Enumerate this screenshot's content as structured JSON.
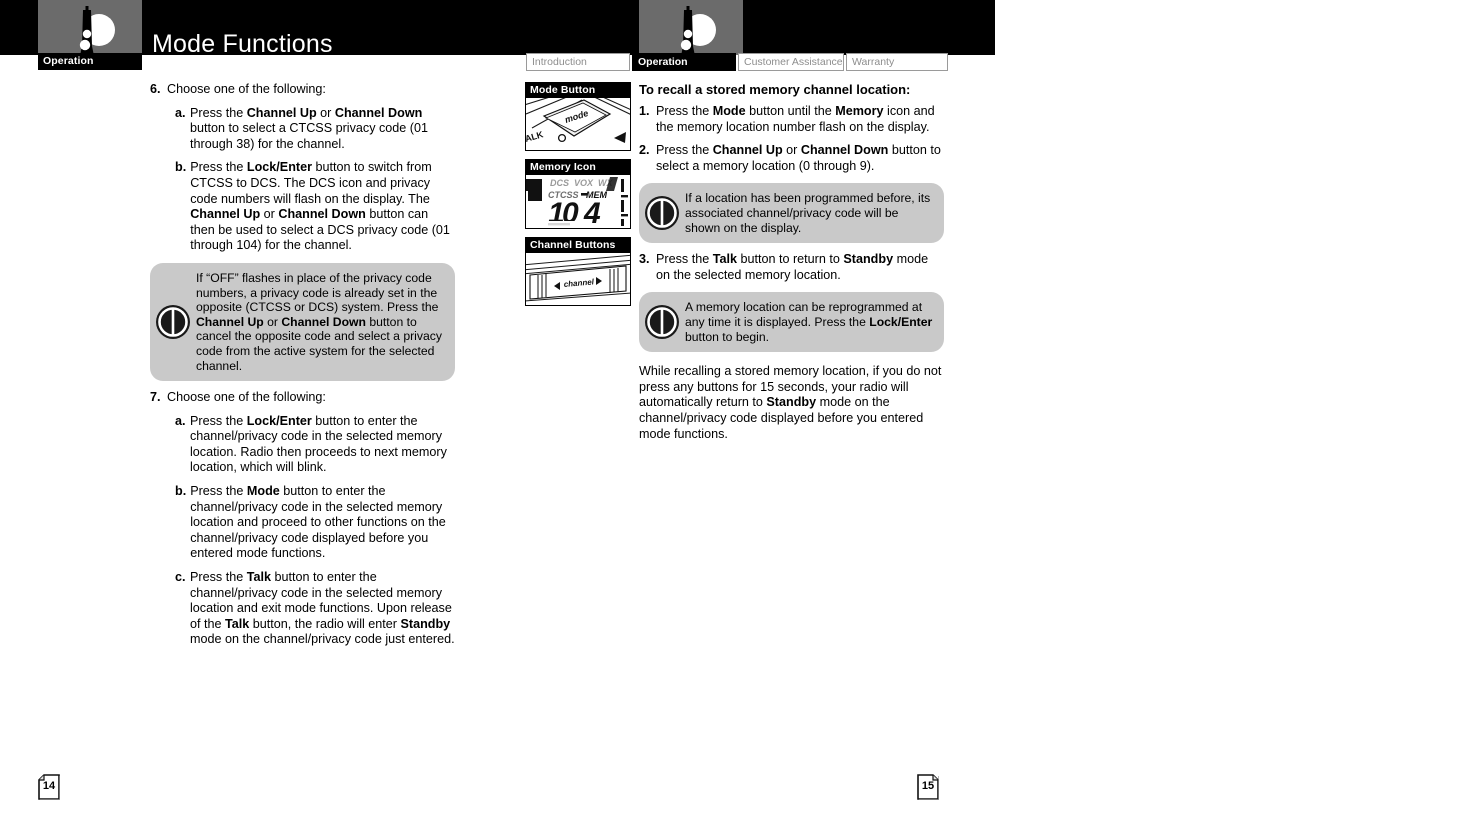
{
  "header": {
    "title": "Mode Functions",
    "logo_tab_label": "Operation",
    "logo_icon": "walkie-talkie-logo-icon"
  },
  "tabs": [
    {
      "label": "Introduction",
      "active": false
    },
    {
      "label": "Operation",
      "active": true
    },
    {
      "label": "Customer Assistance",
      "active": false
    },
    {
      "label": "Warranty",
      "active": false
    }
  ],
  "left_page": {
    "page_number": "14",
    "steps": [
      {
        "marker": "6.",
        "text": "Choose one of the following:",
        "substeps": [
          {
            "marker": "a.",
            "html": "Press the <b>Channel Up</b> or <b>Channel Down</b> button to select a CTCSS privacy code (01 through 38) for the channel."
          },
          {
            "marker": "b.",
            "html": "Press the <b>Lock/Enter</b> button to switch from CTCSS to DCS. The DCS icon and privacy code numbers will flash on the display. The <b>Channel Up</b> or <b>Channel Down</b> button can then be used to select a DCS privacy code (01 through 104) for the channel."
          }
        ]
      }
    ],
    "note": {
      "icon": "note-info-icon",
      "html": "If “OFF” flashes in place of the privacy code numbers, a privacy code is already set in the opposite (CTCSS or DCS) system. Press the <b>Channel Up</b> or <b>Channel Down</b> button to cancel the opposite code and select a privacy code from the active system for the selected channel."
    },
    "steps2": [
      {
        "marker": "7.",
        "text": "Choose one of the following:",
        "substeps": [
          {
            "marker": "a.",
            "html": "Press the <b>Lock/Enter</b> button to enter the channel/privacy code in the selected memory location. Radio then proceeds to next memory location, which will blink."
          },
          {
            "marker": "b.",
            "html": "Press the <b>Mode</b> button to enter the channel/privacy code in the selected memory location and proceed to other functions on the channel/privacy code displayed before you entered mode functions."
          },
          {
            "marker": "c.",
            "html": "Press the <b>Talk</b> button to enter the channel/privacy code in the selected memory location and exit mode functions. Upon release of the <b>Talk</b> button, the radio will enter <b>Standby</b> mode on the channel/privacy code just entered."
          }
        ]
      }
    ]
  },
  "figures": [
    {
      "caption": "Mode Button",
      "art": "mode-button-photo"
    },
    {
      "caption": "Memory Icon",
      "art": "memory-icon-lcd"
    },
    {
      "caption": "Channel Buttons",
      "art": "channel-buttons-photo"
    }
  ],
  "lcd": {
    "labels_top": [
      "DCS",
      "VOX",
      "WX"
    ],
    "labels_second": [
      "CTCSS",
      "MEM"
    ],
    "digits": "104"
  },
  "right_page": {
    "page_number": "15",
    "heading": "To recall a stored memory channel location:",
    "steps": [
      {
        "marker": "1.",
        "html": "Press the <b>Mode</b> button until the <b>Memory</b> icon and the memory location number flash on the display."
      },
      {
        "marker": "2.",
        "html": "Press the <b>Channel Up</b> or <b>Channel Down</b> button to select a memory location (0 through 9)."
      }
    ],
    "note1": {
      "icon": "note-info-icon",
      "html": "If a location has been programmed before, its associated channel/privacy code will be shown on the display."
    },
    "step3": {
      "marker": "3.",
      "html": "Press the <b>Talk</b> button to return to <b>Standby</b> mode on the selected memory location."
    },
    "note2": {
      "icon": "note-info-icon",
      "html": "A memory location can be reprogrammed at any time it is displayed. Press the <b>Lock/Enter</b> button to begin."
    },
    "closing": "While recalling a stored memory location, if you do not press any buttons for 15 seconds, your radio will automatically return to <b>Standby</b> mode on the channel/privacy code displayed before you entered mode functions."
  },
  "colors": {
    "header_bar": "#000000",
    "logo_block": "#6b6b6b",
    "note_bubble": "#c9c9c9",
    "tab_inactive_text": "#8d8d8d",
    "tab_border": "#9a9a9a"
  }
}
